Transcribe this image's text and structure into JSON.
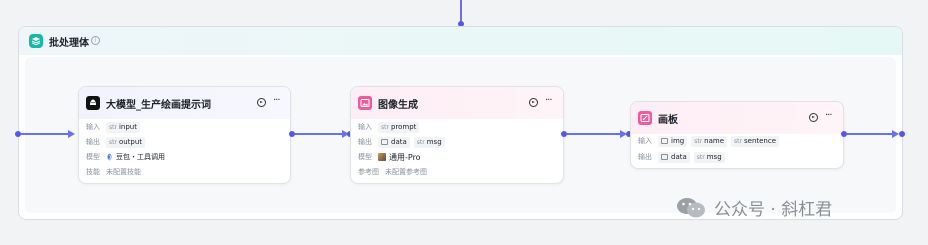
{
  "batch": {
    "title": "批处理体",
    "info_icon": "info-icon"
  },
  "nodes": {
    "llm": {
      "title": "大模型_生产绘画提示词",
      "rows": {
        "input_label": "输入",
        "input_type": "str",
        "input_name": "input",
        "output_label": "输出",
        "output_type": "str",
        "output_name": "output",
        "model_label": "模型",
        "model_value": "豆包・工具调用",
        "skill_label": "技能",
        "skill_value": "未配置技能"
      }
    },
    "image": {
      "title": "图像生成",
      "rows": {
        "input_label": "输入",
        "input_type": "str",
        "input_name": "prompt",
        "output_label": "输出",
        "output_data": "data",
        "output_type": "str",
        "output_msg": "msg",
        "model_label": "模型",
        "model_value": "通用-Pro",
        "ref_label": "参考图",
        "ref_value": "未配置参考图"
      }
    },
    "board": {
      "title": "画板",
      "rows": {
        "input_label": "输入",
        "input_img": "img",
        "input_type1": "str",
        "input_name1": "name",
        "input_type2": "str",
        "input_name2": "sentence",
        "output_label": "输出",
        "output_data": "data",
        "output_type": "str",
        "output_msg": "msg"
      }
    }
  },
  "watermark": {
    "text": "公众号 · 斜杠君"
  },
  "colors": {
    "accent": "#6b6ff0",
    "batch_icon": "#14b8a6",
    "image_icon": "#ee5a9c"
  }
}
